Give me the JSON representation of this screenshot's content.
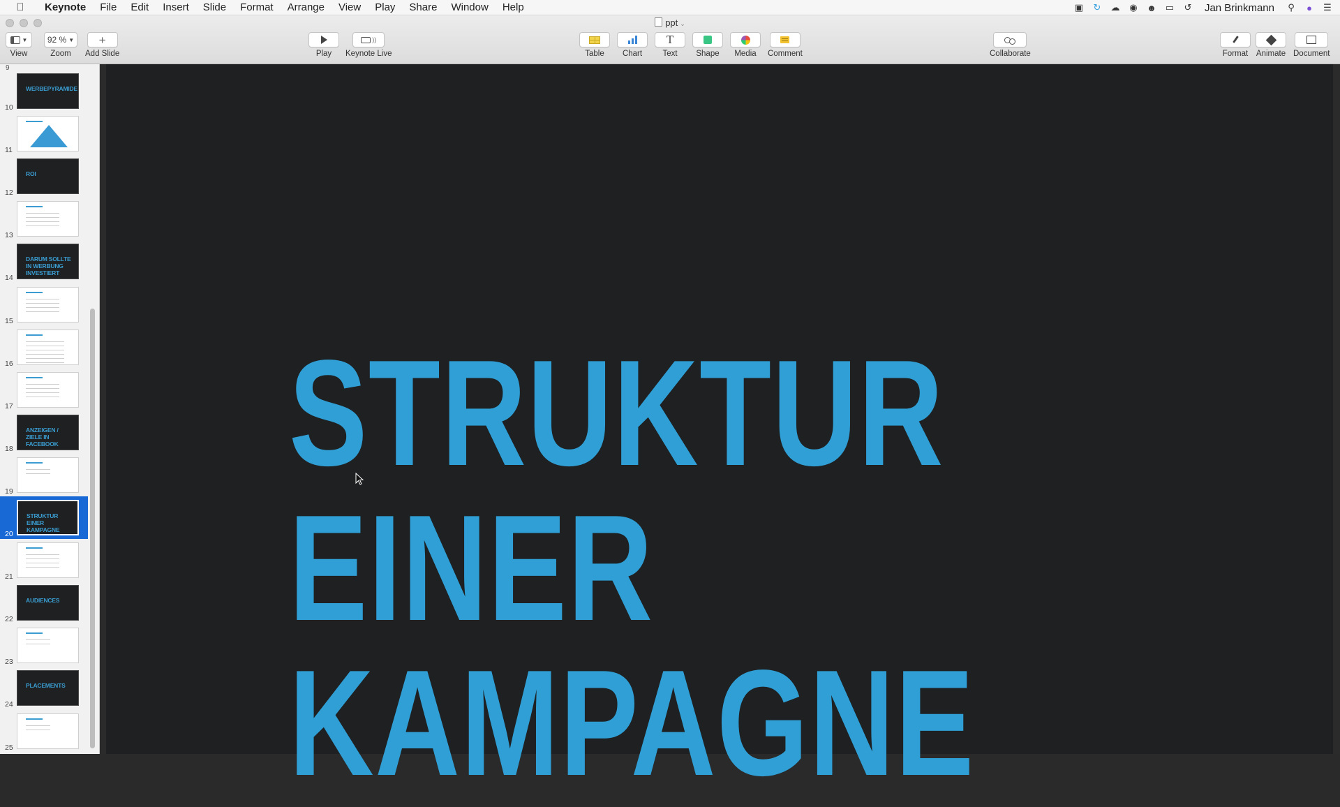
{
  "menubar": {
    "app_name": "Keynote",
    "items": [
      "File",
      "Edit",
      "Insert",
      "Slide",
      "Format",
      "Arrange",
      "View",
      "Play",
      "Share",
      "Window",
      "Help"
    ],
    "user": "Jan Brinkmann"
  },
  "window": {
    "doc_title": "ppt"
  },
  "toolbar": {
    "view_label": "View",
    "zoom_value": "92 %",
    "zoom_label": "Zoom",
    "add_slide_label": "Add Slide",
    "play_label": "Play",
    "keynote_live_label": "Keynote Live",
    "table_label": "Table",
    "chart_label": "Chart",
    "text_label": "Text",
    "shape_label": "Shape",
    "media_label": "Media",
    "comment_label": "Comment",
    "collaborate_label": "Collaborate",
    "format_label": "Format",
    "animate_label": "Animate",
    "document_label": "Document"
  },
  "navigator": {
    "partial_number": "9",
    "slides": [
      {
        "number": "10",
        "style": "dark",
        "text": "WERBEPYRAMIDE"
      },
      {
        "number": "11",
        "style": "pyramid",
        "text": ""
      },
      {
        "number": "12",
        "style": "dark",
        "text": "ROI"
      },
      {
        "number": "13",
        "style": "light",
        "text": ""
      },
      {
        "number": "14",
        "style": "dark",
        "text": "DARUM SOLLTE IN WERBUNG INVESTIERT"
      },
      {
        "number": "15",
        "style": "light",
        "text": ""
      },
      {
        "number": "16",
        "style": "light",
        "text": ""
      },
      {
        "number": "17",
        "style": "light",
        "text": ""
      },
      {
        "number": "18",
        "style": "dark",
        "text": "ANZEIGEN / ZIELE IN FACEBOOK"
      },
      {
        "number": "19",
        "style": "light-short",
        "text": ""
      },
      {
        "number": "20",
        "style": "dark",
        "text": "STRUKTUR EINER KAMPAGNE",
        "selected": true
      },
      {
        "number": "21",
        "style": "light",
        "text": ""
      },
      {
        "number": "22",
        "style": "dark",
        "text": "AUDIENCES"
      },
      {
        "number": "23",
        "style": "light-short",
        "text": ""
      },
      {
        "number": "24",
        "style": "dark",
        "text": "PLACEMENTS"
      },
      {
        "number": "25",
        "style": "light-short",
        "text": ""
      }
    ]
  },
  "slide": {
    "title_line1": "STRUKTUR EINER",
    "title_line2": "KAMPAGNE",
    "title_color": "#2f9fd6",
    "background_color": "#1e2022"
  }
}
